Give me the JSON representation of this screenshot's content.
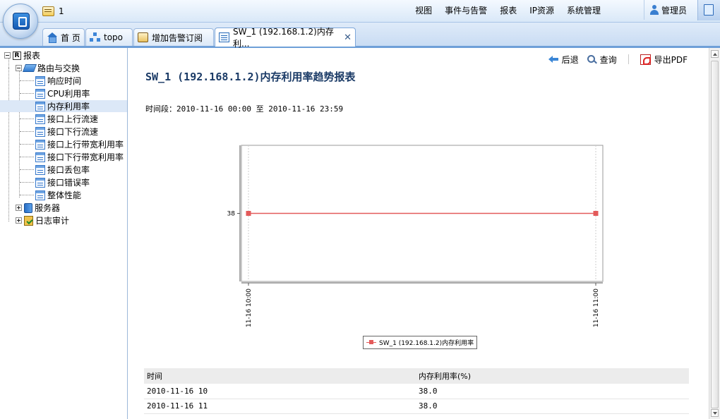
{
  "header": {
    "message_count": "1",
    "menu": [
      "视图",
      "事件与告警",
      "报表",
      "IP资源",
      "系统管理"
    ],
    "user": "管理员"
  },
  "tabs": [
    {
      "label": "首 页",
      "icon": "home-icon"
    },
    {
      "label": "topo",
      "icon": "topology-icon"
    },
    {
      "label": "增加告警订阅",
      "icon": "subscription-icon"
    },
    {
      "label": "SW_1 (192.168.1.2)内存利...",
      "icon": "report-icon",
      "active": true
    }
  ],
  "tree": {
    "root": "报表",
    "group1": "路由与交换",
    "group1_items": [
      "响应时间",
      "CPU利用率",
      "内存利用率",
      "接口上行流速",
      "接口下行流速",
      "接口上行带宽利用率",
      "接口下行带宽利用率",
      "接口丢包率",
      "接口错误率",
      "整体性能"
    ],
    "selected_index": 2,
    "group2": "服务器",
    "group3": "日志审计"
  },
  "actions": {
    "back": "后退",
    "query": "查询",
    "export": "导出PDF"
  },
  "report": {
    "title": "SW_1 (192.168.1.2)内存利用率趋势报表",
    "period": "时间段：2010-11-16 00:00 至 2010-11-16 23:59"
  },
  "chart_data": {
    "type": "line",
    "x": [
      "11-16 10:00",
      "11-16 11:00"
    ],
    "series": [
      {
        "name": "SW_1 (192.168.1.2)内存利用率",
        "values": [
          38,
          38
        ]
      }
    ],
    "y_ticks": [
      38
    ],
    "color": "#e35a5a",
    "grid": true,
    "legend": "bottom-center"
  },
  "table": {
    "headers": [
      "时间",
      "内存利用率(%)"
    ],
    "rows": [
      [
        "2010-11-16 10",
        "38.0"
      ],
      [
        "2010-11-16 11",
        "38.0"
      ]
    ]
  }
}
